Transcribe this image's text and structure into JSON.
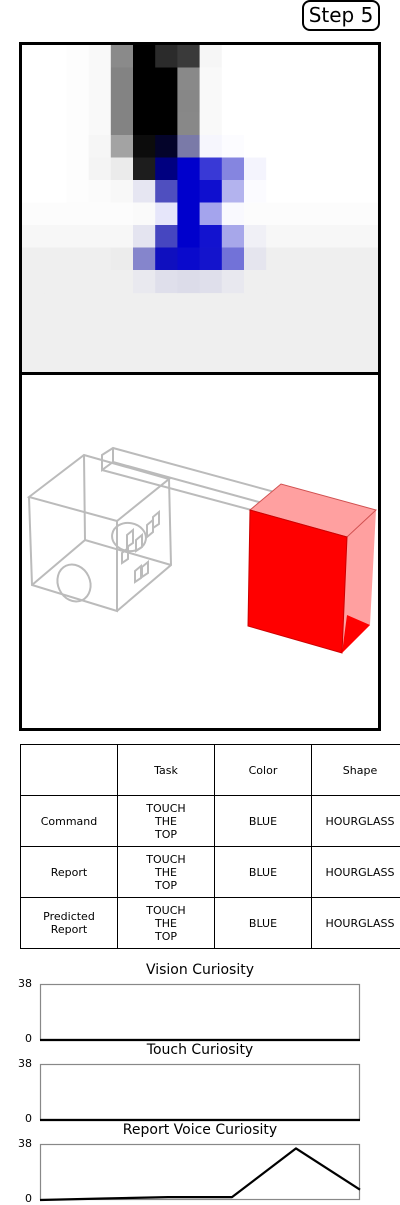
{
  "step_label": "Step 5",
  "top_view": {
    "cols": 16,
    "rows": 11,
    "pixels": [
      [
        "#ffffff",
        "#ffffff",
        "#fdfdfd",
        "#f9f9f9",
        "#8a8a8a",
        "#000000",
        "#2b2b2b",
        "#3a3a3a",
        "#f6f6f6",
        "#ffffff",
        "#ffffff",
        "#ffffff",
        "#ffffff",
        "#ffffff",
        "#ffffff",
        "#ffffff"
      ],
      [
        "#ffffff",
        "#ffffff",
        "#fdfdfd",
        "#f9f9f9",
        "#838383",
        "#000000",
        "#000000",
        "#898989",
        "#f9f9f9",
        "#ffffff",
        "#ffffff",
        "#ffffff",
        "#ffffff",
        "#ffffff",
        "#ffffff",
        "#ffffff"
      ],
      [
        "#ffffff",
        "#ffffff",
        "#fdfdfd",
        "#f9f9f9",
        "#838383",
        "#000000",
        "#000000",
        "#878787",
        "#f9f9f9",
        "#ffffff",
        "#ffffff",
        "#ffffff",
        "#ffffff",
        "#ffffff",
        "#ffffff",
        "#ffffff"
      ],
      [
        "#ffffff",
        "#ffffff",
        "#fdfdfd",
        "#f9f9f9",
        "#838383",
        "#000000",
        "#000000",
        "#888888",
        "#f9f9f9",
        "#ffffff",
        "#ffffff",
        "#ffffff",
        "#ffffff",
        "#ffffff",
        "#ffffff",
        "#ffffff"
      ],
      [
        "#ffffff",
        "#ffffff",
        "#fdfdfd",
        "#f6f6f6",
        "#a3a3a3",
        "#0c0c0c",
        "#04042a",
        "#7a7aa8",
        "#f6f6fd",
        "#fcfcff",
        "#ffffff",
        "#ffffff",
        "#ffffff",
        "#ffffff",
        "#ffffff",
        "#ffffff"
      ],
      [
        "#ffffff",
        "#ffffff",
        "#fdfdfd",
        "#f4f4f4",
        "#ebebeb",
        "#1d1d1d",
        "#000080",
        "#0000cc",
        "#3939d6",
        "#8585e0",
        "#f4f4fd",
        "#ffffff",
        "#ffffff",
        "#ffffff",
        "#ffffff",
        "#ffffff"
      ],
      [
        "#ffffff",
        "#ffffff",
        "#fdfdfd",
        "#fbfbfb",
        "#f8f8f8",
        "#e6e6f2",
        "#4f4fbf",
        "#0000cc",
        "#0f0fcf",
        "#b3b3ee",
        "#fbfbff",
        "#ffffff",
        "#ffffff",
        "#ffffff",
        "#ffffff",
        "#ffffff"
      ],
      [
        "#fcfcfc",
        "#fcfcfc",
        "#fcfcfc",
        "#fcfcfc",
        "#fcfcfc",
        "#fafafa",
        "#e6e6fa",
        "#0000cc",
        "#a4a4ed",
        "#f9f9fe",
        "#fcfcfc",
        "#fcfcfc",
        "#fcfcfc",
        "#fcfcfc",
        "#fcfcfc",
        "#fcfcfc"
      ],
      [
        "#f7f7f7",
        "#f7f7f7",
        "#f7f7f7",
        "#f7f7f7",
        "#f7f7f7",
        "#e4e4f0",
        "#4646c0",
        "#0000cc",
        "#1313cf",
        "#a7a7ea",
        "#f0f0f6",
        "#f7f7f7",
        "#f7f7f7",
        "#f7f7f7",
        "#f7f7f7",
        "#f7f7f7"
      ],
      [
        "#efefef",
        "#efefef",
        "#efefef",
        "#efefef",
        "#ececec",
        "#8585cc",
        "#0f0fbf",
        "#0a0acc",
        "#1414cc",
        "#7272d8",
        "#e5e5ee",
        "#efefef",
        "#efefef",
        "#efefef",
        "#efefef",
        "#efefef"
      ],
      [
        "#efefef",
        "#efefef",
        "#efefef",
        "#efefef",
        "#efefef",
        "#e9e9ef",
        "#dfdfeb",
        "#dcdce9",
        "#dfdfeb",
        "#e8e8ef",
        "#efefef",
        "#efefef",
        "#efefef",
        "#efefef",
        "#efefef",
        "#efefef"
      ]
    ]
  },
  "colors": {
    "target": "#ff0000",
    "target_side": "#ffa0a0",
    "wireframe": "#bbbbbb",
    "line": "#000000"
  },
  "table": {
    "columns": [
      "",
      "Task",
      "Color",
      "Shape"
    ],
    "rows": [
      [
        "Command",
        "TOUCH\nTHE\nTOP",
        "BLUE",
        "HOURGLASS"
      ],
      [
        "Report",
        "TOUCH\nTHE\nTOP",
        "BLUE",
        "HOURGLASS"
      ],
      [
        "Predicted\nReport",
        "TOUCH\nTHE\nTOP",
        "BLUE",
        "HOURGLASS"
      ]
    ]
  },
  "chart_data": [
    {
      "type": "line",
      "title": "Vision Curiosity",
      "yticks": [
        "38",
        "0"
      ],
      "ylim": [
        0,
        38
      ],
      "x": [
        0,
        1,
        2,
        3,
        4,
        5
      ],
      "values": [
        0,
        0,
        0,
        0,
        0,
        0
      ]
    },
    {
      "type": "line",
      "title": "Touch Curiosity",
      "yticks": [
        "38",
        "0"
      ],
      "ylim": [
        0,
        38
      ],
      "x": [
        0,
        1,
        2,
        3,
        4,
        5
      ],
      "values": [
        0,
        0,
        0,
        0,
        0,
        0
      ]
    },
    {
      "type": "line",
      "title": "Report Voice Curiosity",
      "yticks": [
        "38",
        "0"
      ],
      "ylim": [
        0,
        38
      ],
      "x": [
        0,
        1,
        2,
        3,
        4,
        5
      ],
      "values": [
        0,
        1,
        2,
        2,
        35,
        7
      ]
    }
  ]
}
